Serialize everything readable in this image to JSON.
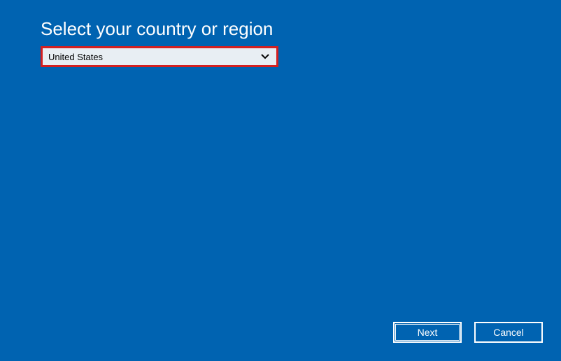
{
  "header": {
    "title": "Select your country or region"
  },
  "main": {
    "country_dropdown": {
      "selected": "United States"
    }
  },
  "footer": {
    "next_label": "Next",
    "cancel_label": "Cancel"
  },
  "colors": {
    "background": "#0063b1",
    "highlight_border": "#d42020",
    "button_border": "#ffffff",
    "text_light": "#ffffff",
    "dropdown_bg": "#e8eef3"
  }
}
